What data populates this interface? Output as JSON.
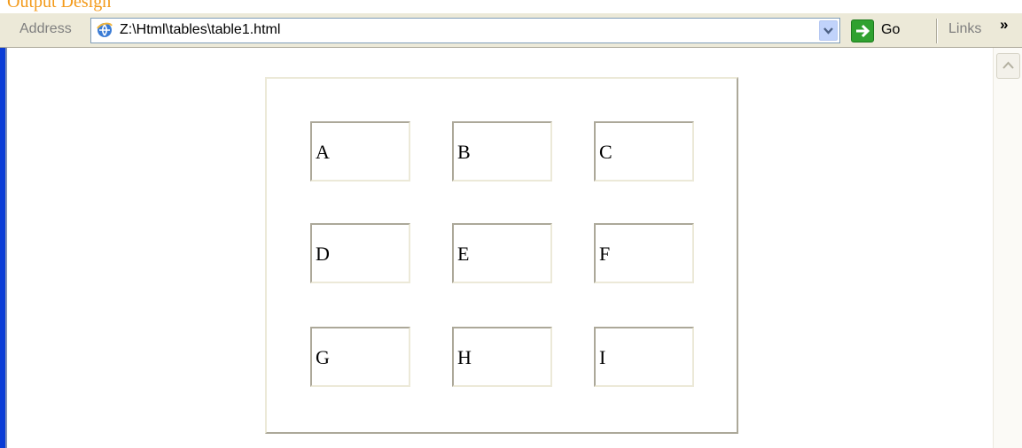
{
  "page_heading": "Output Design",
  "address_bar": {
    "label": "Address",
    "url": "Z:\\Html\\tables\\table1.html",
    "go_label": "Go",
    "links_label": "Links",
    "overflow": "»"
  },
  "table": {
    "rows": [
      [
        "A",
        "B",
        "C"
      ],
      [
        "D",
        "E",
        "F"
      ],
      [
        "G",
        "H",
        "I"
      ]
    ]
  },
  "colors": {
    "heading": "#f39a1a",
    "toolbar_bg": "#ece9d8",
    "go_green": "#2fa12f"
  }
}
